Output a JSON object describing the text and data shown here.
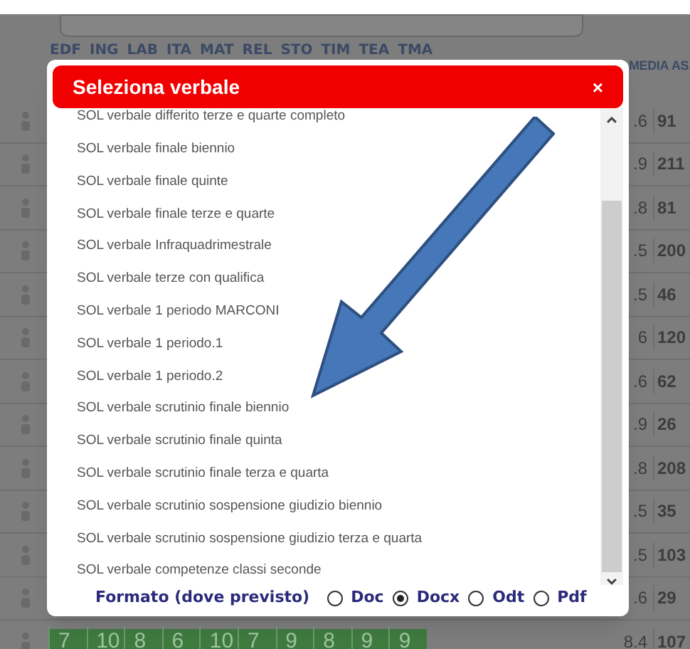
{
  "background_table": {
    "columns": [
      "EDF",
      "ING",
      "LAB",
      "ITA",
      "MAT",
      "REL",
      "STO",
      "TIM",
      "TEA",
      "TMA"
    ],
    "summary_columns": [
      "MEDIA",
      "AS"
    ],
    "rows": [
      {
        "media": ".6",
        "ass": "91"
      },
      {
        "media": ".9",
        "ass": "211"
      },
      {
        "media": ".8",
        "ass": "81"
      },
      {
        "media": ".5",
        "ass": "200"
      },
      {
        "media": ".5",
        "ass": "46"
      },
      {
        "media": "6",
        "ass": "120"
      },
      {
        "media": ".6",
        "ass": "62"
      },
      {
        "media": ".9",
        "ass": "26"
      },
      {
        "media": ".8",
        "ass": "208"
      },
      {
        "media": ".5",
        "ass": "35"
      },
      {
        "media": ".5",
        "ass": "103"
      },
      {
        "media": ".6",
        "ass": "29"
      },
      {
        "media": "8.4",
        "ass": "107"
      }
    ],
    "last_row_grades": [
      "7",
      "10",
      "8",
      "6",
      "10",
      "7",
      "9",
      "8",
      "9",
      "9"
    ]
  },
  "modal": {
    "title": "Seleziona verbale",
    "close": "×",
    "items": [
      "SOL verbale differito terze e quarte completo",
      "SOL verbale finale biennio",
      "SOL verbale finale quinte",
      "SOL verbale finale terze e quarte",
      "SOL verbale Infraquadrimestrale",
      "SOL verbale terze con qualifica",
      "SOL verbale 1 periodo MARCONI",
      "SOL verbale 1 periodo.1",
      "SOL verbale 1 periodo.2",
      "SOL verbale scrutinio finale biennio",
      "SOL verbale scrutinio finale quinta",
      "SOL verbale scrutinio finale terza e quarta",
      "SOL verbale scrutinio sospensione giudizio biennio",
      "SOL verbale scrutinio sospensione giudizio terza e quarta",
      "SOL verbale competenze classi seconde"
    ],
    "format_label": "Formato (dove previsto)",
    "formats": [
      {
        "label": "Doc",
        "selected": false
      },
      {
        "label": "Docx",
        "selected": true
      },
      {
        "label": "Odt",
        "selected": false
      },
      {
        "label": "Pdf",
        "selected": false
      }
    ]
  }
}
